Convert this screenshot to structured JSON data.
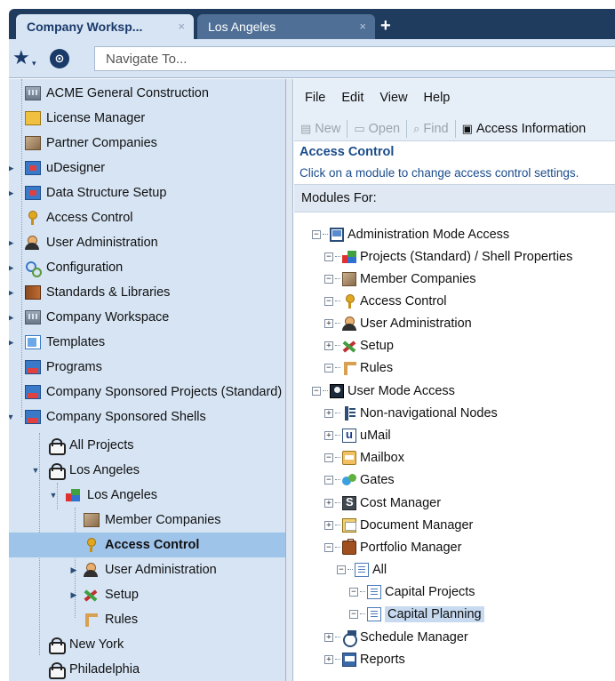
{
  "tabs": [
    {
      "label": "Company Worksp...",
      "close": "×"
    },
    {
      "label": "Los Angeles",
      "close": "×"
    }
  ],
  "new_tab_label": "+",
  "nav": {
    "star_glyph": "★",
    "caret_glyph": "▾",
    "globe_glyph": "⊙",
    "placeholder": "Navigate To..."
  },
  "left_tree": [
    {
      "label": "ACME General Construction",
      "icon": "building-icon"
    },
    {
      "label": "License Manager",
      "icon": "license-icon"
    },
    {
      "label": "Partner Companies",
      "icon": "partner-companies-icon"
    },
    {
      "label": "uDesigner",
      "icon": "udesigner-icon"
    },
    {
      "label": "Data Structure Setup",
      "icon": "data-structure-icon"
    },
    {
      "label": "Access Control",
      "icon": "key-icon"
    },
    {
      "label": "User Administration",
      "icon": "users-icon"
    },
    {
      "label": "Configuration",
      "icon": "configuration-icon"
    },
    {
      "label": "Standards & Libraries",
      "icon": "book-icon"
    },
    {
      "label": "Company Workspace",
      "icon": "building-icon"
    },
    {
      "label": "Templates",
      "icon": "template-icon"
    },
    {
      "label": "Programs",
      "icon": "program-icon"
    },
    {
      "label": "Company Sponsored Projects (Standard)",
      "icon": "program-icon"
    },
    {
      "label": "Company Sponsored Shells",
      "icon": "program-icon"
    },
    {
      "label": "All Projects",
      "icon": "pin-icon"
    },
    {
      "label": "Los Angeles",
      "icon": "pin-icon"
    },
    {
      "label": "Los Angeles",
      "icon": "shell-icon"
    },
    {
      "label": "Member Companies",
      "icon": "partner-companies-icon"
    },
    {
      "label": "Access Control",
      "icon": "key-icon"
    },
    {
      "label": "User Administration",
      "icon": "users-icon"
    },
    {
      "label": "Setup",
      "icon": "setup-icon"
    },
    {
      "label": "Rules",
      "icon": "rules-icon"
    },
    {
      "label": "New York",
      "icon": "pin-icon"
    },
    {
      "label": "Philadelphia",
      "icon": "pin-icon"
    }
  ],
  "menu": [
    "File",
    "Edit",
    "View",
    "Help"
  ],
  "toolbar": {
    "new_label": "New",
    "open_label": "Open",
    "find_label": "Find",
    "access_label": "Access Information"
  },
  "section": {
    "title": "Access Control",
    "description": "Click on a module to change access control settings."
  },
  "modules_header": "Modules For:",
  "module_tree": [
    {
      "label": "Administration Mode Access",
      "icon": "admin-mode-icon"
    },
    {
      "label": "Projects (Standard) / Shell Properties",
      "icon": "shell-icon"
    },
    {
      "label": "Member Companies",
      "icon": "partner-companies-icon"
    },
    {
      "label": "Access Control",
      "icon": "key-icon"
    },
    {
      "label": "User Administration",
      "icon": "users-icon"
    },
    {
      "label": "Setup",
      "icon": "setup-icon"
    },
    {
      "label": "Rules",
      "icon": "rules-icon"
    },
    {
      "label": "User Mode Access",
      "icon": "user-mode-icon"
    },
    {
      "label": "Non-navigational Nodes",
      "icon": "non-nav-icon"
    },
    {
      "label": "uMail",
      "icon": "umail-icon"
    },
    {
      "label": "Mailbox",
      "icon": "mailbox-icon"
    },
    {
      "label": "Gates",
      "icon": "gates-icon"
    },
    {
      "label": "Cost Manager",
      "icon": "cost-manager-icon"
    },
    {
      "label": "Document Manager",
      "icon": "document-manager-icon"
    },
    {
      "label": "Portfolio Manager",
      "icon": "portfolio-icon"
    },
    {
      "label": "All",
      "icon": "document-icon"
    },
    {
      "label": "Capital Projects",
      "icon": "document-icon"
    },
    {
      "label": "Capital Planning",
      "icon": "document-icon"
    },
    {
      "label": "Schedule Manager",
      "icon": "schedule-icon"
    },
    {
      "label": "Reports",
      "icon": "reports-icon"
    }
  ],
  "colors": {
    "tab_bar": "#1f3b5e",
    "panel_bg": "#d6e4f4",
    "selection": "#9fc4ea",
    "link_blue": "#1a4c8c"
  }
}
